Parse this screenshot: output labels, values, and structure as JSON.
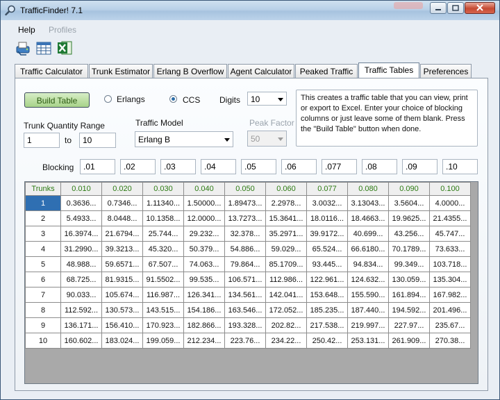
{
  "window": {
    "title": "TrafficFinder! 7.1"
  },
  "menu": {
    "items": [
      "Help",
      "Profiles"
    ]
  },
  "toolbar": {
    "icons": [
      "print-icon",
      "table-icon",
      "excel-icon"
    ]
  },
  "tabs": [
    "Traffic Calculator",
    "Trunk Estimator",
    "Erlang B Overflow",
    "Agent Calculator",
    "Peaked Traffic",
    "Traffic Tables",
    "Preferences"
  ],
  "active_tab": "Traffic Tables",
  "form": {
    "build_label": "Build Table",
    "units": {
      "erlangs": "Erlangs",
      "ccs": "CCS",
      "selected": "CCS"
    },
    "digits_label": "Digits",
    "digits_value": "10",
    "trunk_range_label": "Trunk Quantity Range",
    "trunk_from": "1",
    "to_label": "to",
    "trunk_to": "10",
    "traffic_model_label": "Traffic Model",
    "traffic_model_value": "Erlang B",
    "peak_factor_label": "Peak Factor",
    "peak_factor_value": "50",
    "info_text": "This creates a traffic table that you can view, print or export to Excel.  Enter your choice of blocking columns or just leave some of them blank.  Press the \"Build Table\" button when done.",
    "blocking_label": "Blocking",
    "blocking_values": [
      ".01",
      ".02",
      ".03",
      ".04",
      ".05",
      ".06",
      ".077",
      ".08",
      ".09",
      ".10"
    ]
  },
  "table": {
    "columns": [
      "Trunks",
      "0.010",
      "0.020",
      "0.030",
      "0.040",
      "0.050",
      "0.060",
      "0.077",
      "0.080",
      "0.090",
      "0.100"
    ],
    "rows": [
      [
        "1",
        "0.3636...",
        "0.7346...",
        "1.11340...",
        "1.50000...",
        "1.89473...",
        "2.2978...",
        "3.0032...",
        "3.13043...",
        "3.5604...",
        "4.0000..."
      ],
      [
        "2",
        "5.4933...",
        "8.0448...",
        "10.1358...",
        "12.0000...",
        "13.7273...",
        "15.3641...",
        "18.0116...",
        "18.4663...",
        "19.9625...",
        "21.4355..."
      ],
      [
        "3",
        "16.3974...",
        "21.6794...",
        "25.744...",
        "29.232...",
        "32.378...",
        "35.2971...",
        "39.9172...",
        "40.699...",
        "43.256...",
        "45.747..."
      ],
      [
        "4",
        "31.2990...",
        "39.3213...",
        "45.320...",
        "50.379...",
        "54.886...",
        "59.029...",
        "65.524...",
        "66.6180...",
        "70.1789...",
        "73.633..."
      ],
      [
        "5",
        "48.988...",
        "59.6571...",
        "67.507...",
        "74.063...",
        "79.864...",
        "85.1709...",
        "93.445...",
        "94.834...",
        "99.349...",
        "103.718..."
      ],
      [
        "6",
        "68.725...",
        "81.9315...",
        "91.5502...",
        "99.535...",
        "106.571...",
        "112.986...",
        "122.961...",
        "124.632...",
        "130.059...",
        "135.304..."
      ],
      [
        "7",
        "90.033...",
        "105.674...",
        "116.987...",
        "126.341...",
        "134.561...",
        "142.041...",
        "153.648...",
        "155.590...",
        "161.894...",
        "167.982..."
      ],
      [
        "8",
        "112.592...",
        "130.573...",
        "143.515...",
        "154.186...",
        "163.546...",
        "172.052...",
        "185.235...",
        "187.440...",
        "194.592...",
        "201.496..."
      ],
      [
        "9",
        "136.171...",
        "156.410...",
        "170.923...",
        "182.866...",
        "193.328...",
        "202.82...",
        "217.538...",
        "219.997...",
        "227.97...",
        "235.67..."
      ],
      [
        "10",
        "160.602...",
        "183.024...",
        "199.059...",
        "212.234...",
        "223.76...",
        "234.22...",
        "250.42...",
        "253.131...",
        "261.909...",
        "270.38..."
      ]
    ],
    "selected_row": 0
  },
  "colors": {
    "header_text": "#2b7a12",
    "selection": "#2f6fb2",
    "build_button": "#bfe0a6"
  }
}
